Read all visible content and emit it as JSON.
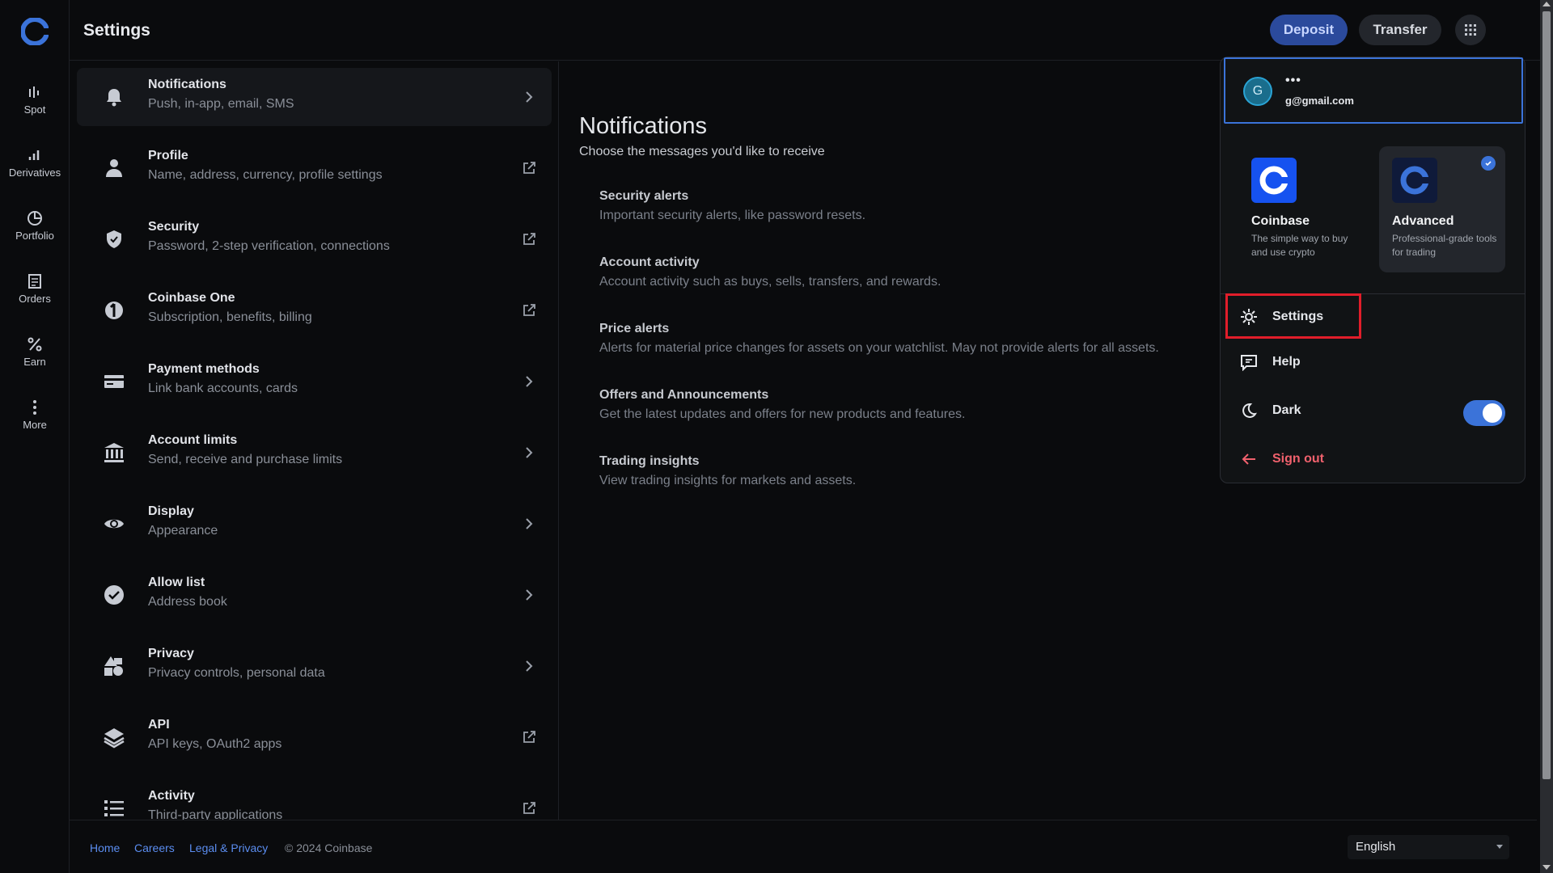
{
  "header": {
    "title": "Settings",
    "deposit_label": "Deposit",
    "transfer_label": "Transfer",
    "avatar_initial": "G"
  },
  "rail": {
    "items": [
      {
        "label": "Spot",
        "icon": "spot-icon"
      },
      {
        "label": "Derivatives",
        "icon": "derivatives-icon"
      },
      {
        "label": "Portfolio",
        "icon": "portfolio-icon"
      },
      {
        "label": "Orders",
        "icon": "orders-icon"
      },
      {
        "label": "Earn",
        "icon": "earn-icon"
      },
      {
        "label": "More",
        "icon": "more-icon"
      }
    ]
  },
  "settings_list": [
    {
      "title": "Notifications",
      "subtitle": "Push, in-app, email, SMS",
      "icon": "bell-icon",
      "action": "chevron"
    },
    {
      "title": "Profile",
      "subtitle": "Name, address, currency, profile settings",
      "icon": "person-icon",
      "action": "external"
    },
    {
      "title": "Security",
      "subtitle": "Password, 2-step verification, connections",
      "icon": "shield-icon",
      "action": "external"
    },
    {
      "title": "Coinbase One",
      "subtitle": "Subscription, benefits, billing",
      "icon": "coinbase-one-icon",
      "action": "external"
    },
    {
      "title": "Payment methods",
      "subtitle": "Link bank accounts, cards",
      "icon": "card-icon",
      "action": "chevron"
    },
    {
      "title": "Account limits",
      "subtitle": "Send, receive and purchase limits",
      "icon": "bank-icon",
      "action": "chevron"
    },
    {
      "title": "Display",
      "subtitle": "Appearance",
      "icon": "eye-icon",
      "action": "chevron"
    },
    {
      "title": "Allow list",
      "subtitle": "Address book",
      "icon": "check-circle-icon",
      "action": "chevron"
    },
    {
      "title": "Privacy",
      "subtitle": "Privacy controls, personal data",
      "icon": "shapes-icon",
      "action": "chevron"
    },
    {
      "title": "API",
      "subtitle": "API keys, OAuth2 apps",
      "icon": "layers-icon",
      "action": "external"
    },
    {
      "title": "Activity",
      "subtitle": "Third-party applications",
      "icon": "list-icon",
      "action": "external"
    }
  ],
  "content": {
    "title": "Notifications",
    "subtitle": "Choose the messages you'd like to receive",
    "items": [
      {
        "title": "Security alerts",
        "desc": "Important security alerts, like password resets."
      },
      {
        "title": "Account activity",
        "desc": "Account activity such as buys, sells, transfers, and rewards."
      },
      {
        "title": "Price alerts",
        "desc": "Alerts for material price changes for assets on your watchlist. May not provide alerts for all assets."
      },
      {
        "title": "Offers and Announcements",
        "desc": "Get the latest updates and offers for new products and features."
      },
      {
        "title": "Trading insights",
        "desc": "View trading insights for markets and assets."
      }
    ]
  },
  "menu": {
    "account": {
      "initial": "G",
      "name": "•••",
      "email": "g@gmail.com"
    },
    "apps": [
      {
        "name": "Coinbase",
        "desc": "The simple way to buy and use crypto",
        "selected": false
      },
      {
        "name": "Advanced",
        "desc": "Professional-grade tools for trading",
        "selected": true
      }
    ],
    "settings_label": "Settings",
    "help_label": "Help",
    "dark_label": "Dark",
    "dark_enabled": true,
    "signout_label": "Sign out"
  },
  "footer": {
    "home": "Home",
    "careers": "Careers",
    "legal": "Legal & Privacy",
    "copyright": "© 2024 Coinbase",
    "language": "English"
  },
  "colors": {
    "accent": "#3b73d9",
    "highlight": "#e11d2a",
    "signout": "#f0616d",
    "brand": "#1652f0"
  }
}
